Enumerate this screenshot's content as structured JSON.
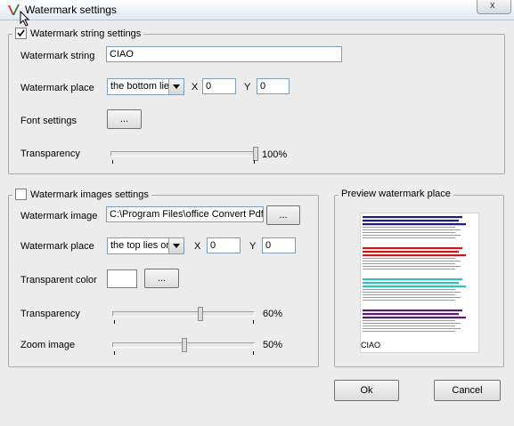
{
  "window": {
    "title": "Watermark settings",
    "close_label": "x"
  },
  "string_section": {
    "legend": "Watermark string settings",
    "checked": true,
    "watermark_string_label": "Watermark string",
    "watermark_string_value": "CIAO",
    "watermark_place_label": "Watermark place",
    "watermark_place_value": "the bottom lie",
    "x_label": "X",
    "x_value": "0",
    "y_label": "Y",
    "y_value": "0",
    "font_settings_label": "Font settings",
    "font_button": "...",
    "transparency_label": "Transparency",
    "transparency_value_text": "100%",
    "transparency_value": 100
  },
  "image_section": {
    "legend": "Watermark images settings",
    "checked": false,
    "watermark_image_label": "Watermark image",
    "watermark_image_value": "C:\\Program Files\\office Convert Pdf",
    "browse_button": "...",
    "watermark_place_label": "Watermark place",
    "watermark_place_value": "the top lies or",
    "x_label": "X",
    "x_value": "0",
    "y_label": "Y",
    "y_value": "0",
    "transparent_color_label": "Transparent color",
    "color_button": "...",
    "transparency_label": "Transparency",
    "transparency_value_text": "60%",
    "transparency_value": 60,
    "zoom_label": "Zoom image",
    "zoom_value_text": "50%",
    "zoom_value": 50
  },
  "preview": {
    "legend": "Preview watermark place",
    "watermark_text": "CIAO",
    "bar_colors": [
      "#1a1a8c",
      "#c41a1a",
      "#27c4c4",
      "#5b1a6e"
    ]
  },
  "buttons": {
    "ok": "Ok",
    "cancel": "Cancel"
  }
}
